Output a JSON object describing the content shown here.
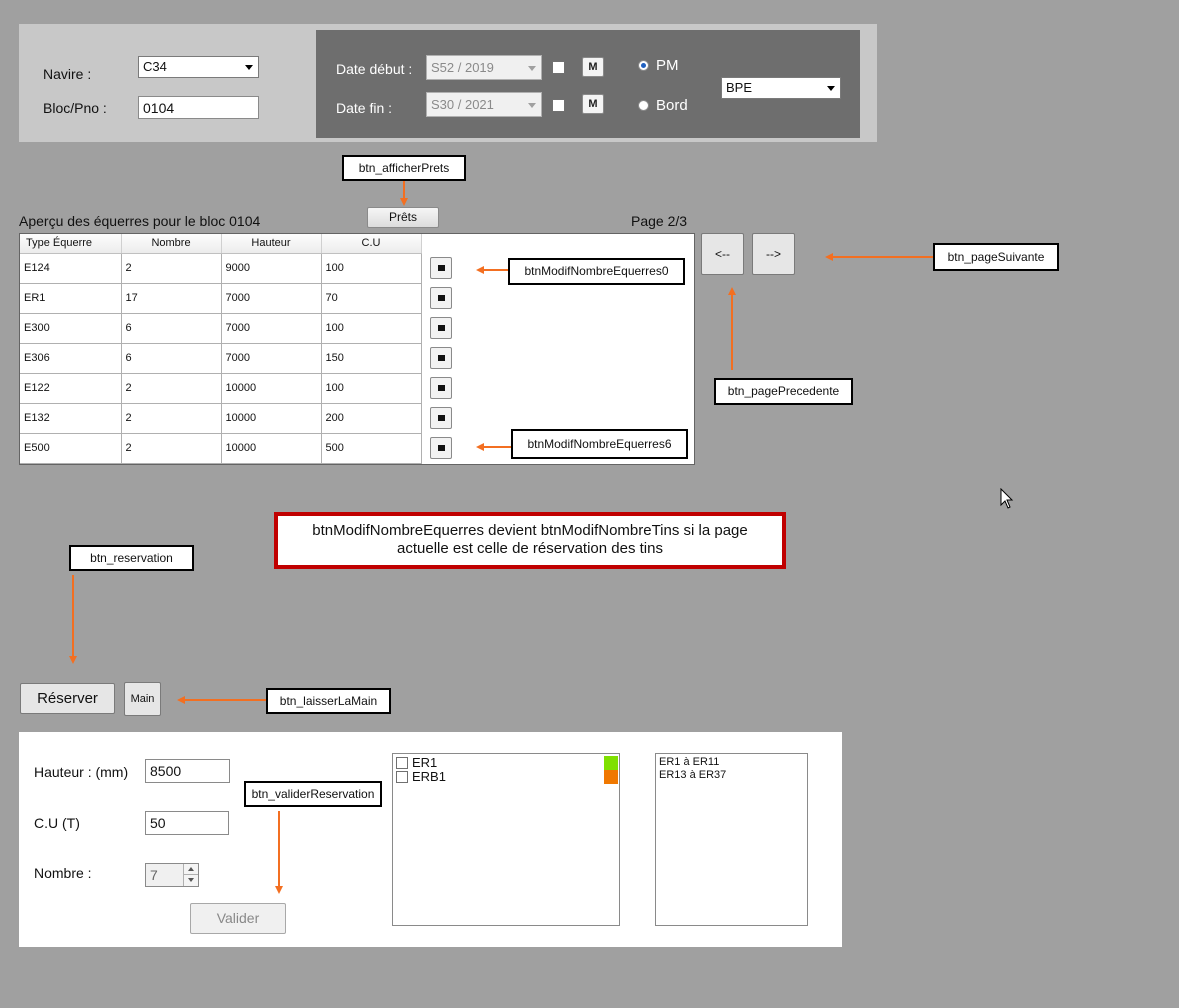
{
  "header": {
    "navire_label": "Navire :",
    "navire_value": "C34",
    "bloc_label": "Bloc/Pno :",
    "bloc_value": "0104",
    "date_debut_label": "Date début :",
    "date_debut_value": "S52 / 2019",
    "date_fin_label": "Date fin :",
    "date_fin_value": "S30 / 2021",
    "m_label": "M",
    "radio_pm_label": "PM",
    "radio_bord_label": "Bord",
    "radio_selected": "PM",
    "type_value": "BPE"
  },
  "annotations": {
    "afficher_prets": "btn_afficherPrets",
    "modif0": "btnModifNombreEquerres0",
    "modif6": "btnModifNombreEquerres6",
    "page_suivante": "btn_pageSuivante",
    "page_precedente": "btn_pagePrecedente",
    "reservation": "btn_reservation",
    "laisser_main": "btn_laisserLaMain",
    "valider_reservation": "btn_validerReservation",
    "note_line1": "btnModifNombreEquerres devient btnModifNombreTins si la page",
    "note_line2": "actuelle est celle de réservation des tins"
  },
  "grid": {
    "title": "Aperçu des équerres pour le bloc 0104",
    "prets_label": "Prêts",
    "page_label": "Page 2/3",
    "prev_label": "<--",
    "next_label": "-->",
    "columns": [
      "Type Équerre",
      "Nombre",
      "Hauteur",
      "C.U"
    ],
    "rows": [
      [
        "E124",
        "2",
        "9000",
        "100"
      ],
      [
        "ER1",
        "17",
        "7000",
        "70"
      ],
      [
        "E300",
        "6",
        "7000",
        "100"
      ],
      [
        "E306",
        "6",
        "7000",
        "150"
      ],
      [
        "E122",
        "2",
        "10000",
        "100"
      ],
      [
        "E132",
        "2",
        "10000",
        "200"
      ],
      [
        "E500",
        "2",
        "10000",
        "500"
      ]
    ]
  },
  "actions": {
    "reserver_label": "Réserver",
    "main_label": "Main"
  },
  "reservation": {
    "hauteur_label": "Hauteur : (mm)",
    "hauteur_value": "8500",
    "cu_label": "C.U (T)",
    "cu_value": "50",
    "nombre_label": "Nombre :",
    "nombre_value": "7",
    "valider_label": "Valider",
    "list_items": [
      {
        "label": "ER1",
        "color": "#7fe000"
      },
      {
        "label": "ERB1",
        "color": "#f07800"
      }
    ],
    "ranges": [
      "ER1 à ER11",
      "ER13 à ER37"
    ]
  },
  "colors": {
    "arrow": "#f36f21",
    "note_border": "#c00000"
  }
}
